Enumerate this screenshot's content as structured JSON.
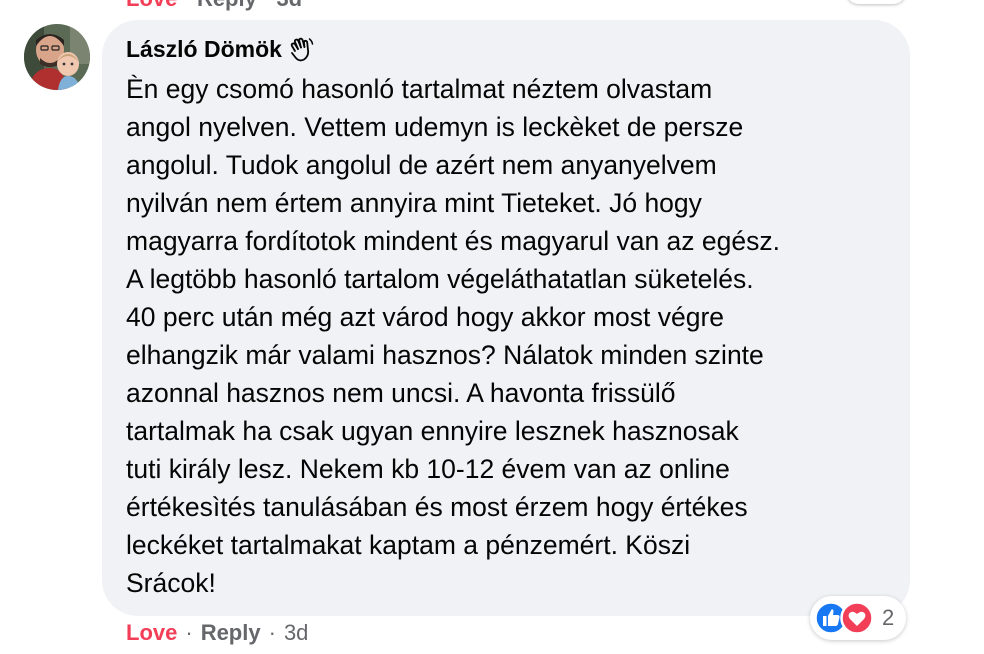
{
  "previous_comment": {
    "love_label": "Love",
    "separator": "·",
    "reply_label": "Reply",
    "time": "3d"
  },
  "comment": {
    "author": "László Dömök",
    "author_badge_icon": "waving-hand-icon",
    "lines": [
      "Èn egy csomó hasonló tartalmat néztem olvastam",
      "angol nyelven. Vettem udemyn is leckèket de persze",
      "angolul. Tudok angolul de azért nem anyanyelvem",
      "nyilván nem értem annyira mint Tieteket. Jó hogy",
      "magyarra fordítotok mindent és magyarul van az egész.",
      "A legtöbb hasonló tartalom végeláthatatlan süketelés.",
      "40 perc után még azt várod hogy akkor most végre",
      "elhangzik már valami hasznos? Nálatok minden szinte",
      "azonnal hasznos nem uncsi. A havonta frissülő",
      "tartalmak ha csak ugyan ennyire lesznek hasznosak",
      "tuti király lesz. Nekem kb 10-12 évem van az online",
      "értékesìtés tanulásában és most érzem hogy értékes",
      "leckéket tartalmakat kaptam a pénzemért. Köszi",
      "Srácok!"
    ],
    "actions": {
      "love_label": "Love",
      "separator": "·",
      "reply_label": "Reply",
      "time": "3d"
    },
    "reactions": {
      "icons": [
        "like-icon",
        "heart-icon"
      ],
      "count": "2"
    }
  },
  "colors": {
    "bubble_bg": "#f0f2f5",
    "love": "#f33e58",
    "meta": "#65676b",
    "like_blue": "#1877f2",
    "heart_red": "#f33e58"
  }
}
